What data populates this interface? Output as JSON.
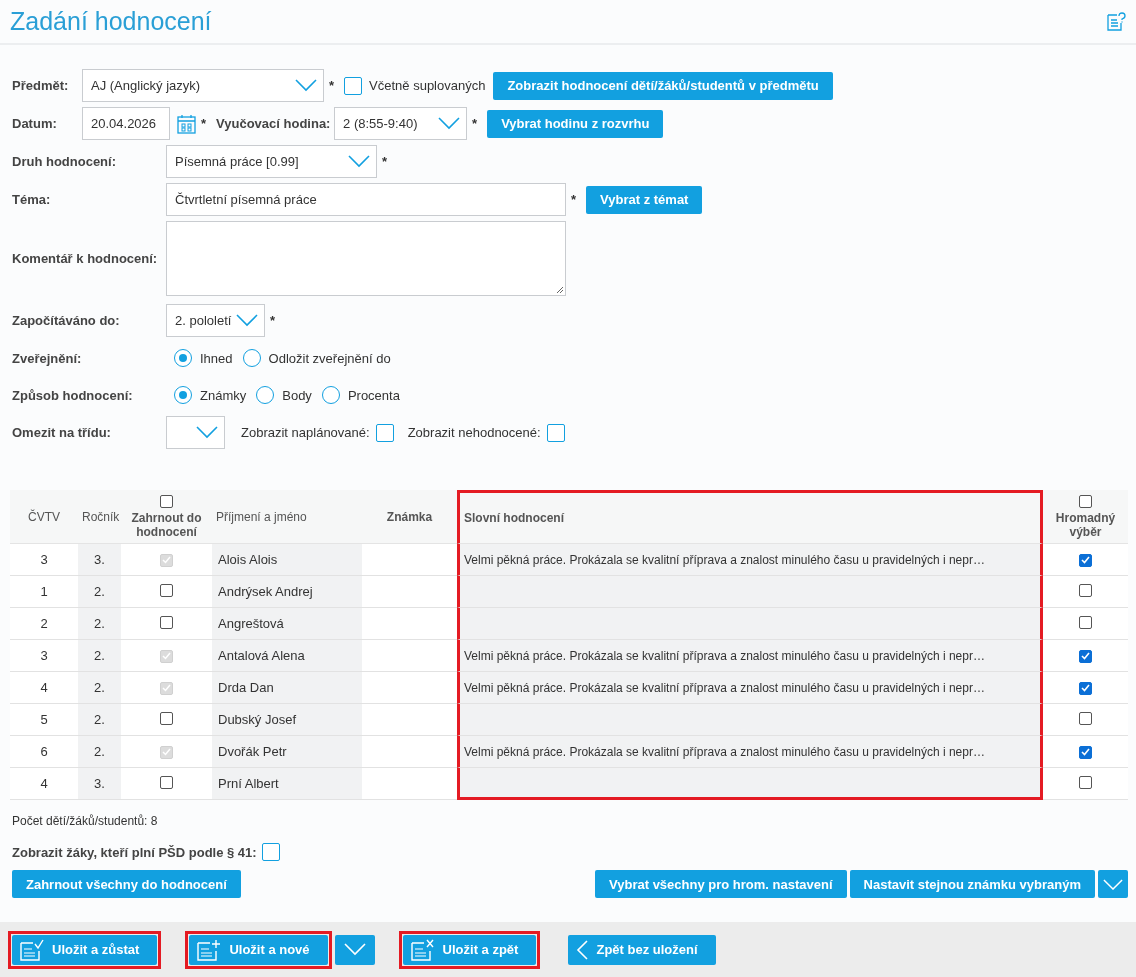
{
  "page": {
    "title": "Zadání hodnocení"
  },
  "form": {
    "subject": {
      "label": "Předmět:",
      "value": "AJ (Anglický jazyk)",
      "required": "*"
    },
    "include_substitutions": {
      "label": "Včetně suplovaných",
      "checked": false
    },
    "show_button": "Zobrazit hodnocení dětí/žáků/studentů v předmětu",
    "date": {
      "label": "Datum:",
      "value": "20.04.2026",
      "required": "*"
    },
    "lesson": {
      "label": "Vyučovací hodina:",
      "value": "2 (8:55-9:40)",
      "required": "*"
    },
    "lesson_button": "Vybrat hodinu z rozvrhu",
    "type": {
      "label": "Druh hodnocení:",
      "value": "Písemná práce [0.99]",
      "required": "*"
    },
    "topic": {
      "label": "Téma:",
      "value": "Čtvrtletní písemná práce",
      "required": "*"
    },
    "topic_button": "Vybrat z témat",
    "comment": {
      "label": "Komentář k hodnocení:"
    },
    "counted": {
      "label": "Započítáváno do:",
      "value": "2. pololetí",
      "required": "*"
    },
    "publish": {
      "label": "Zveřejnění:",
      "options": [
        {
          "label": "Ihned",
          "selected": true
        },
        {
          "label": "Odložit zveřejnění do",
          "selected": false
        }
      ]
    },
    "method": {
      "label": "Způsob hodnocení:",
      "options": [
        {
          "label": "Známky",
          "selected": true
        },
        {
          "label": "Body",
          "selected": false
        },
        {
          "label": "Procenta",
          "selected": false
        }
      ]
    },
    "class_filter": {
      "label": "Omezit na třídu:"
    },
    "show_planned": {
      "label": "Zobrazit naplánované:",
      "checked": false
    },
    "show_ungraded": {
      "label": "Zobrazit nehodnocené:",
      "checked": false
    }
  },
  "table": {
    "columns": [
      {
        "label": "ČVTV",
        "bold": false,
        "highlighted": false
      },
      {
        "label": "Ročník",
        "bold": false,
        "highlighted": false
      },
      {
        "label": "Zahrnout do hodnocení",
        "bold": true,
        "highlighted": false,
        "checkbox": {
          "checked": false
        }
      },
      {
        "label": "Příjmení a jméno",
        "bold": false,
        "highlighted": false
      },
      {
        "label": "Známka",
        "bold": true,
        "highlighted": false
      },
      {
        "label": "Slovní hodnocení",
        "bold": true,
        "highlighted": true
      },
      {
        "label": "Hromadný výběr",
        "bold": true,
        "highlighted": false,
        "checkbox": {
          "checked": false
        }
      }
    ],
    "rows": [
      {
        "cvtv": "3",
        "year": "3.",
        "included": true,
        "name": "Alois Alois",
        "verbal": "Velmi pěkná práce. Prokázala se kvalitní příprava a znalost minulého času u pravidelných i nepr…",
        "bulk": true
      },
      {
        "cvtv": "1",
        "year": "2.",
        "included": false,
        "name": "Andrýsek Andrej",
        "bulk": false
      },
      {
        "cvtv": "2",
        "year": "2.",
        "included": false,
        "name": "Angreštová",
        "bulk": false
      },
      {
        "cvtv": "3",
        "year": "2.",
        "included": true,
        "name": "Antalová Alena",
        "verbal": "Velmi pěkná práce. Prokázala se kvalitní příprava a znalost minulého času u pravidelných i nepr…",
        "bulk": true
      },
      {
        "cvtv": "4",
        "year": "2.",
        "included": true,
        "name": "Drda Dan",
        "verbal": "Velmi pěkná práce. Prokázala se kvalitní příprava a znalost minulého času u pravidelných i nepr…",
        "bulk": true
      },
      {
        "cvtv": "5",
        "year": "2.",
        "included": false,
        "name": "Dubský Josef",
        "bulk": false
      },
      {
        "cvtv": "6",
        "year": "2.",
        "included": true,
        "name": "Dvořák Petr",
        "verbal": "Velmi pěkná práce. Prokázala se kvalitní příprava a znalost minulého času u pravidelných i nepr…",
        "bulk": true
      },
      {
        "cvtv": "4",
        "year": "3.",
        "included": false,
        "name": "Prní Albert",
        "bulk": false
      }
    ]
  },
  "summary": "Počet dětí/žáků/studentů: 8",
  "psd": {
    "label": "Zobrazit žáky, kteří plní PŠD podle § 41:",
    "checked": false
  },
  "include_all_button": "Zahrnout všechny do hodnocení",
  "select_all_button": "Vybrat všechny pro hrom. nastavení",
  "same_grade_button": "Nastavit stejnou známku vybraným",
  "footer": [
    {
      "label": "Uložit a zůstat",
      "kind": "check",
      "highlighted": true,
      "dropdown": false
    },
    {
      "label": "Uložit a nové",
      "kind": "plus",
      "highlighted": true,
      "dropdown": true
    },
    {
      "label": "Uložit a zpět",
      "kind": "cross",
      "highlighted": true,
      "dropdown": false
    },
    {
      "label": "Zpět bez uložení",
      "kind": "back",
      "highlighted": false,
      "dropdown": false
    }
  ]
}
